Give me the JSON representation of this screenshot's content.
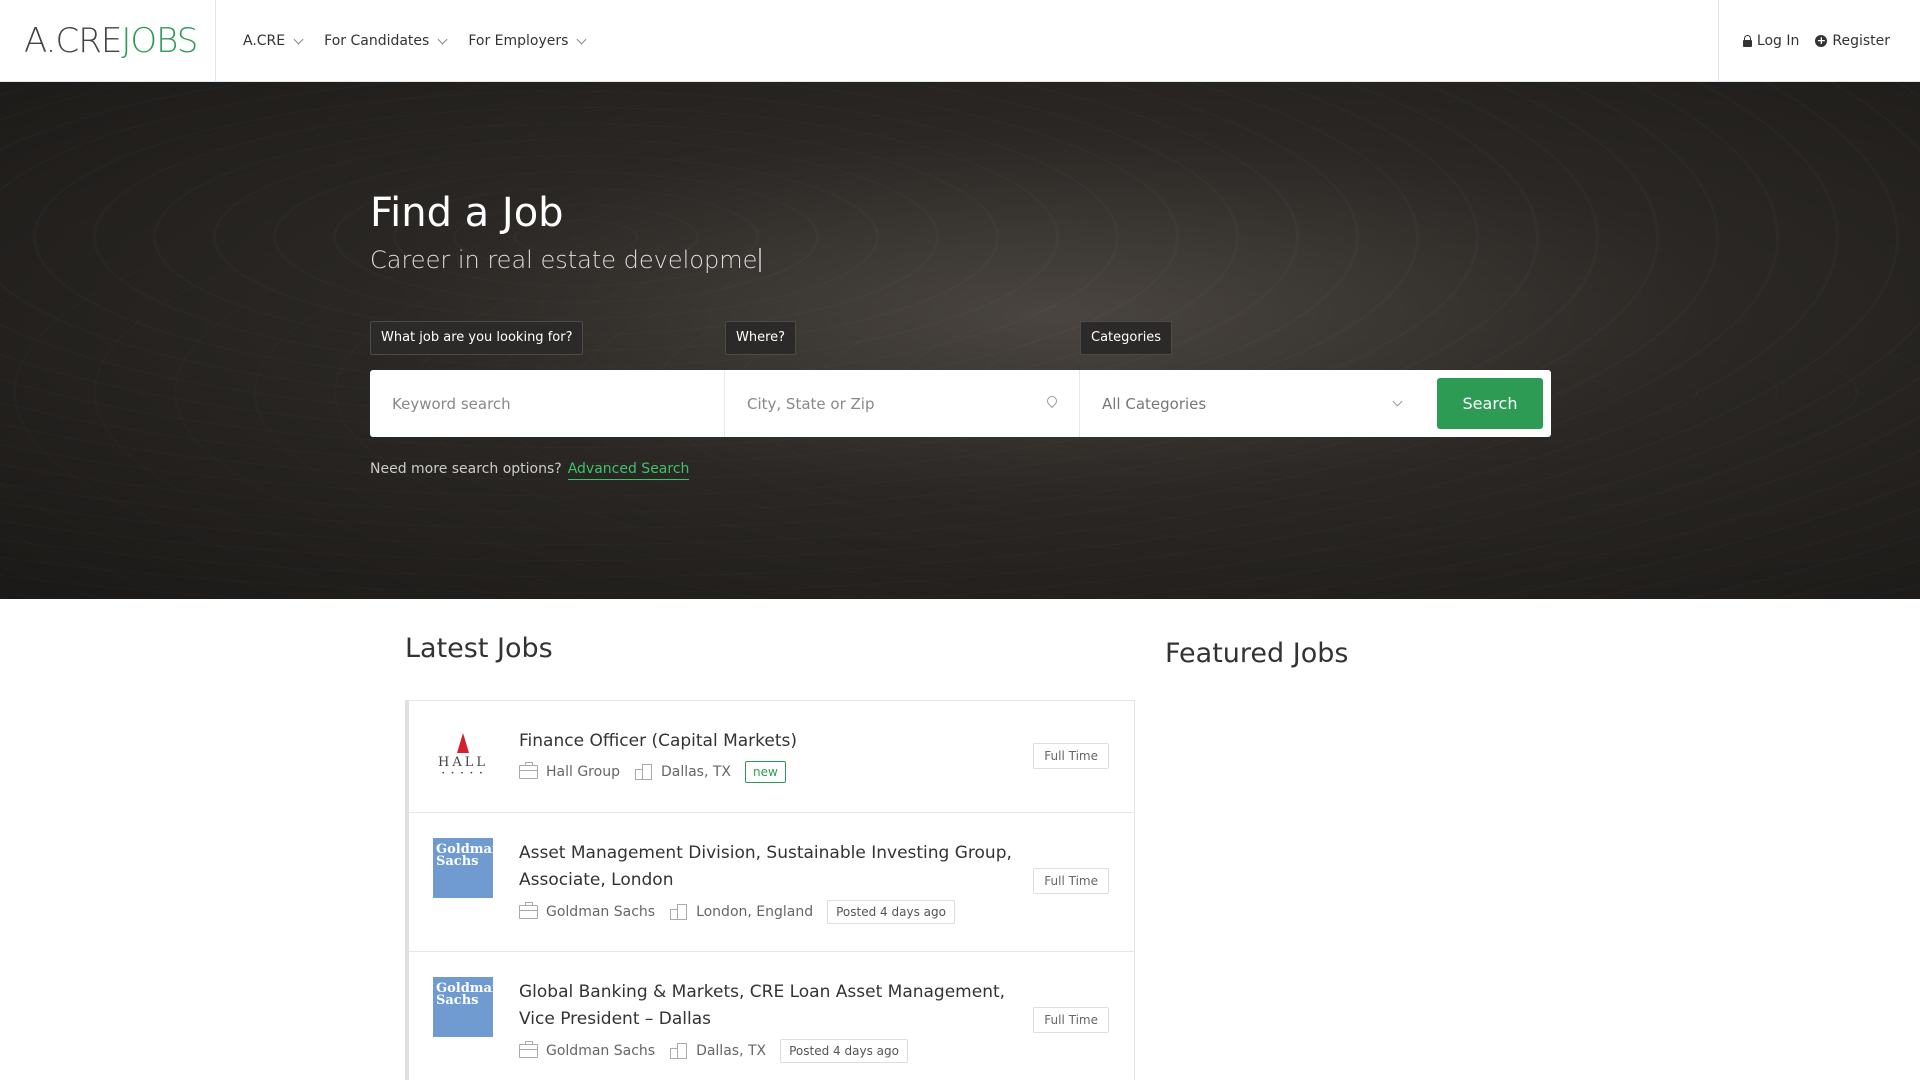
{
  "header": {
    "logo_part1": "A.CRE",
    "logo_part2": "JOBS",
    "nav": [
      "A.CRE",
      "For Candidates",
      "For Employers"
    ],
    "login": "Log In",
    "register": "Register"
  },
  "hero": {
    "title": "Find a Job",
    "subtitle": "Career in real estate developme",
    "labels": {
      "keyword": "What job are you looking for?",
      "where": "Where?",
      "categories": "Categories"
    },
    "keyword_placeholder": "Keyword search",
    "location_placeholder": "City, State or Zip",
    "category_selected": "All Categories",
    "search_button": "Search",
    "more_options_text": "Need more search options?",
    "advanced_search": "Advanced Search"
  },
  "latest": {
    "title": "Latest Jobs",
    "jobs": [
      {
        "title": "Finance Officer (Capital Markets)",
        "company": "Hall Group",
        "location": "Dallas, TX",
        "badge": "new",
        "type": "Full Time",
        "logo": "HALL",
        "logo_dots": "• • • • •"
      },
      {
        "title": "Asset Management Division, Sustainable Investing Group, Associate, London",
        "company": "Goldman Sachs",
        "location": "London, England",
        "badge": "Posted 4 days ago",
        "type": "Full Time",
        "logo": "Goldman Sachs"
      },
      {
        "title": "Global Banking & Markets, CRE Loan Asset Management, Vice President – Dallas",
        "company": "Goldman Sachs",
        "location": "Dallas, TX",
        "badge": "Posted 4 days ago",
        "type": "Full Time",
        "logo": "Goldman Sachs"
      }
    ]
  },
  "featured": {
    "title": "Featured Jobs"
  },
  "colors": {
    "brand_green": "#2e9b55",
    "hero_bg": "#2a2724",
    "goldman_blue": "#6f9bd1",
    "hall_red": "#d3202f"
  }
}
